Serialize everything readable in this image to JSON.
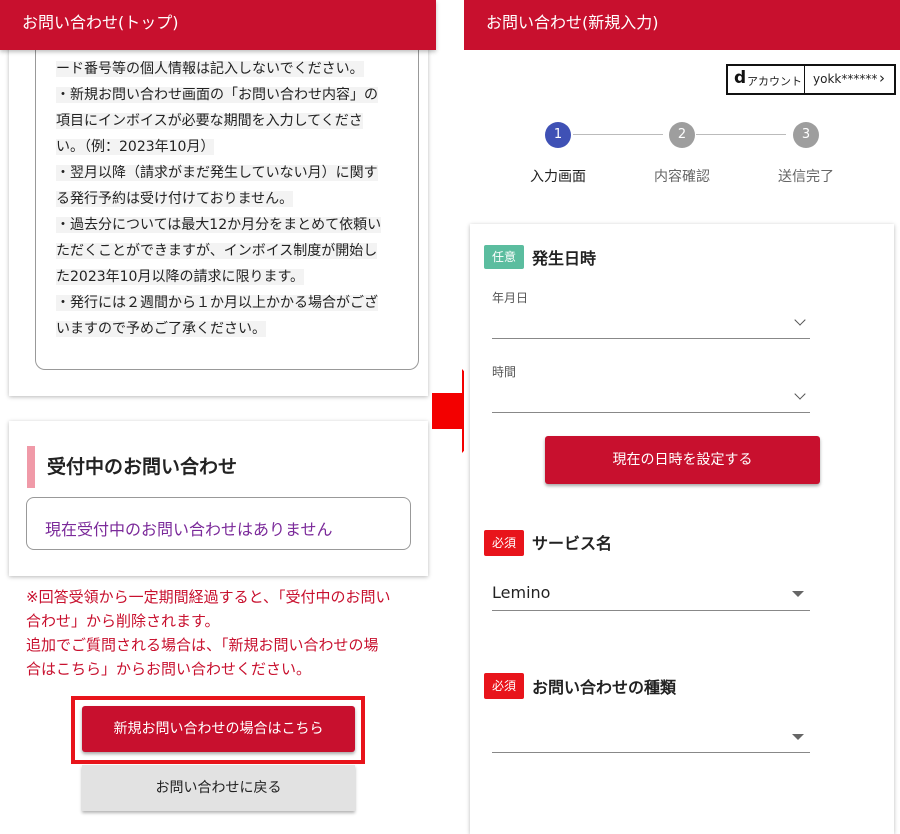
{
  "left": {
    "header_title": "お問い合わせ(トップ)",
    "notice_lines": [
      "ード番号等の個人情報は記入しないでください。",
      "・新規お問い合わせ画面の「お問い合わせ内容」の",
      "項目にインボイスが必要な期間を入力してくださ",
      "い。（例：2023年10月）",
      "・翌月以降（請求がまだ発生していない月）に関す",
      "る発行予約は受け付けておりません。",
      "・過去分については最大12か月分をまとめて依頼い",
      "ただくことができますが、インボイス制度が開始し",
      "た2023年10月以降の請求に限ります。",
      "・発行には２週間から１か月以上かかる場合がござ",
      "いますので予めご了承ください。"
    ],
    "section_title": "受付中のお問い合わせ",
    "empty_message": "現在受付中のお問い合わせはありません",
    "warning_lines": [
      "※回答受領から一定期間経過すると、「受付中のお問い",
      "合わせ」から削除されます。",
      "追加でご質問される場合は、「新規お問い合わせの場",
      "合はこちら」からお問い合わせください。"
    ],
    "new_inquiry_button": "新規お問い合わせの場合はこちら",
    "back_button": "お問い合わせに戻る"
  },
  "right": {
    "header_title": "お問い合わせ(新規入力)",
    "d_account": {
      "logo": "d",
      "label": "アカウント",
      "user": "yokk******",
      "chevron": "›"
    },
    "steps": [
      {
        "num": "1",
        "label": "入力画面"
      },
      {
        "num": "2",
        "label": "内容確認"
      },
      {
        "num": "3",
        "label": "送信完了"
      }
    ],
    "occurrence": {
      "tag": "任意",
      "title": "発生日時",
      "date_label": "年月日",
      "time_label": "時間",
      "set_now_button": "現在の日時を設定する"
    },
    "service": {
      "tag": "必須",
      "title": "サービス名",
      "value": "Lemino"
    },
    "inquiry_type": {
      "tag": "必須",
      "title": "お問い合わせの種類",
      "value": ""
    }
  },
  "colors": {
    "brand_red": "#c8102e",
    "optional_tag": "#5bbd9f",
    "required_tag": "#e8141b",
    "step_active": "#3f51b5",
    "step_inactive": "#9e9e9e",
    "arrow": "#f30000"
  },
  "icons": {
    "dropdown": "chevron-down-icon",
    "select": "triangle-down-icon",
    "arrow": "right-arrow-icon"
  }
}
